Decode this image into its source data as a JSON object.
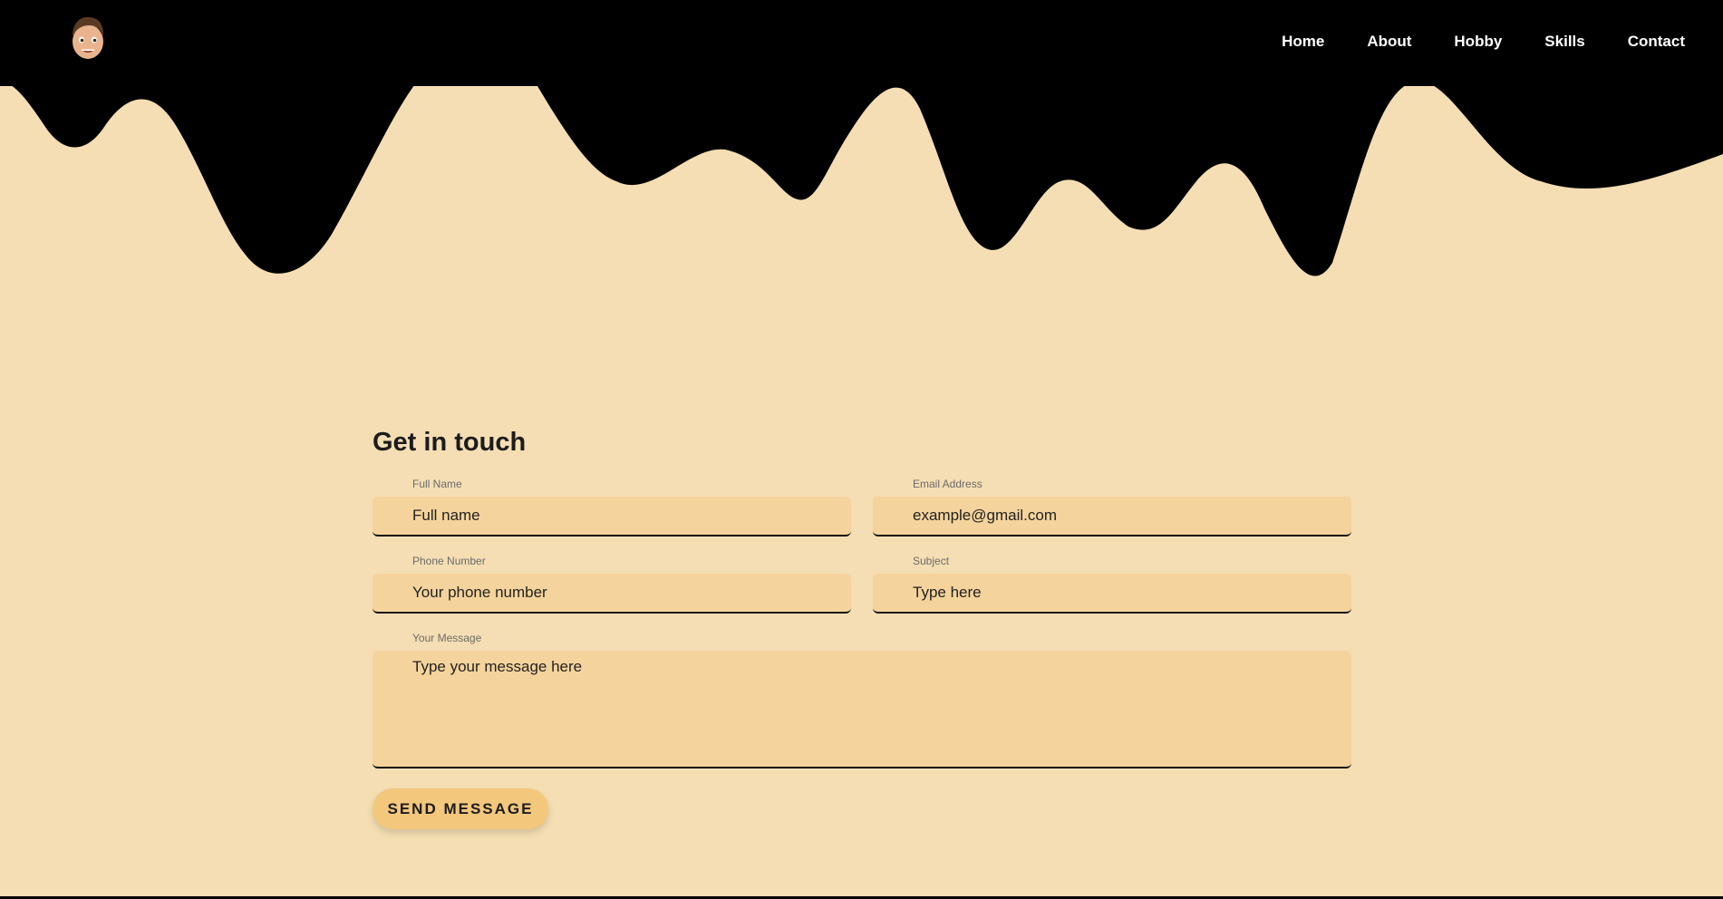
{
  "nav": {
    "items": [
      {
        "label": "Home"
      },
      {
        "label": "About"
      },
      {
        "label": "Hobby"
      },
      {
        "label": "Skills"
      },
      {
        "label": "Contact"
      }
    ]
  },
  "contact": {
    "title": "Get in touch",
    "full_name": {
      "label": "Full Name",
      "placeholder": "Full name"
    },
    "email": {
      "label": "Email Address",
      "placeholder": "example@gmail.com"
    },
    "phone": {
      "label": "Phone Number",
      "placeholder": "Your phone number"
    },
    "subject": {
      "label": "Subject",
      "placeholder": "Type here"
    },
    "message": {
      "label": "Your Message",
      "placeholder": "Type your message here"
    },
    "send_label": "SEND MESSAGE"
  },
  "colors": {
    "background": "#f5deb3",
    "header": "#000000",
    "input_bg": "#f5d39c",
    "button_bg": "#f3c77c",
    "text": "#1c1c1c"
  },
  "icons": {
    "logo": "memoji-avatar-icon"
  }
}
